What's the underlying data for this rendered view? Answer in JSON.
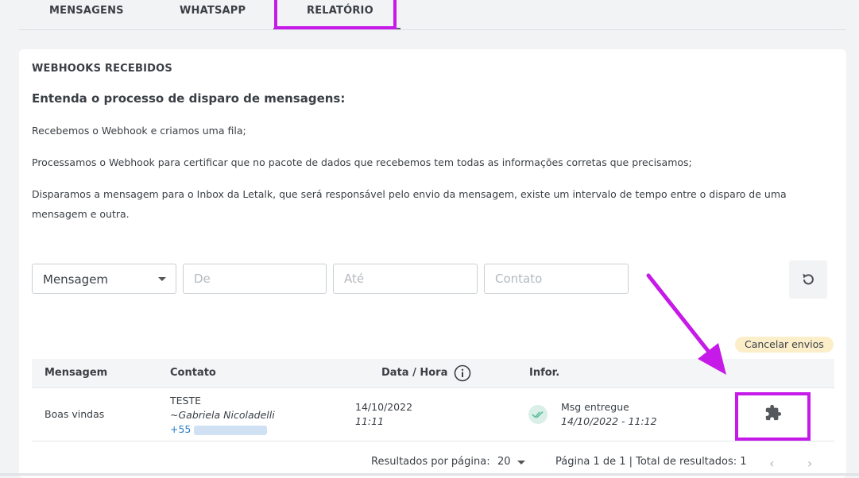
{
  "tabs": [
    {
      "label": "MENSAGENS"
    },
    {
      "label": "WHATSAPP"
    },
    {
      "label": "RELATÓRIO",
      "active": true
    }
  ],
  "card": {
    "title": "WEBHOOKS RECEBIDOS",
    "subtitle": "Entenda o processo de disparo de mensagens:",
    "paragraphs": [
      "Recebemos o Webhook e criamos uma fila;",
      "Processamos o Webhook para certificar que no pacote de dados que recebemos tem todas as informações corretas que precisamos;",
      "Disparamos a mensagem para o Inbox da Letalk, que será responsável pelo envio da mensagem, existe um intervalo de tempo entre o disparo de uma mensagem e outra."
    ]
  },
  "filters": {
    "type_select": "Mensagem",
    "from_placeholder": "De",
    "to_placeholder": "Até",
    "contact_placeholder": "Contato"
  },
  "actions": {
    "cancel_label": "Cancelar envios"
  },
  "table": {
    "headers": {
      "message": "Mensagem",
      "contact": "Contato",
      "datetime": "Data / Hora",
      "info": "Infor."
    },
    "rows": [
      {
        "message": "Boas vindas",
        "contact_name": "TESTE",
        "contact_sub": "~Gabriela Nicoladelli",
        "contact_phone_prefix": "+55",
        "date": "14/10/2022",
        "time": "11:11",
        "status": "Msg entregue",
        "status_time": "14/10/2022 - 11:12",
        "action_icon": "puzzle-icon"
      }
    ]
  },
  "pagination": {
    "per_page_label": "Resultados por página:",
    "per_page_value": "20",
    "info": "Página 1 de 1 | Total de resultados: 1"
  },
  "colors": {
    "highlight": "#c61ae8",
    "cancel_pill": "#fbeec9",
    "link": "#2a7cc7"
  }
}
